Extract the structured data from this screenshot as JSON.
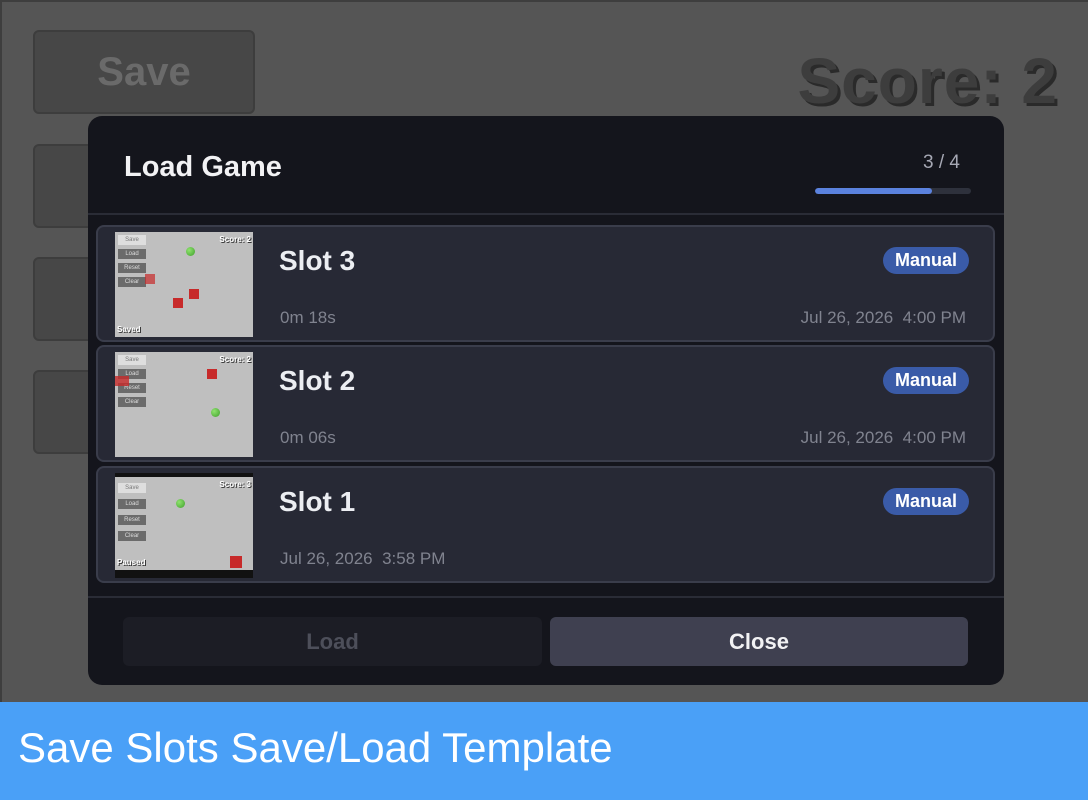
{
  "game": {
    "save_label": "Save",
    "score_text": "Score: 2"
  },
  "modal": {
    "title": "Load Game",
    "page_indicator": "3 / 4",
    "progress_fraction": 0.75,
    "progress_color": "#5b82de",
    "slots": [
      {
        "name": "Slot 3",
        "badge": "Manual",
        "meta_left": "0m 18s",
        "meta_right": "Jul 26, 2026  4:00 PM",
        "thumb": {
          "buttons": [
            "Save",
            "Load",
            "Reset",
            "Clear"
          ],
          "score": "Score: 2",
          "status": "Saved"
        }
      },
      {
        "name": "Slot 2",
        "badge": "Manual",
        "meta_left": "0m 06s",
        "meta_right": "Jul 26, 2026  4:00 PM",
        "thumb": {
          "buttons": [
            "Save",
            "Load",
            "Reset",
            "Clear"
          ],
          "score": "Score: 2",
          "status": ""
        }
      },
      {
        "name": "Slot 1",
        "badge": "Manual",
        "meta_left": "Jul 26, 2026  3:58 PM",
        "meta_right": "",
        "thumb": {
          "buttons": [
            "Save",
            "Load",
            "Reset",
            "Clear"
          ],
          "score": "Score: 3",
          "status": "Paused"
        }
      }
    ],
    "load_label": "Load",
    "close_label": "Close"
  },
  "banner": {
    "text": "Save Slots Save/Load Template",
    "color": "#4aa0f7"
  }
}
